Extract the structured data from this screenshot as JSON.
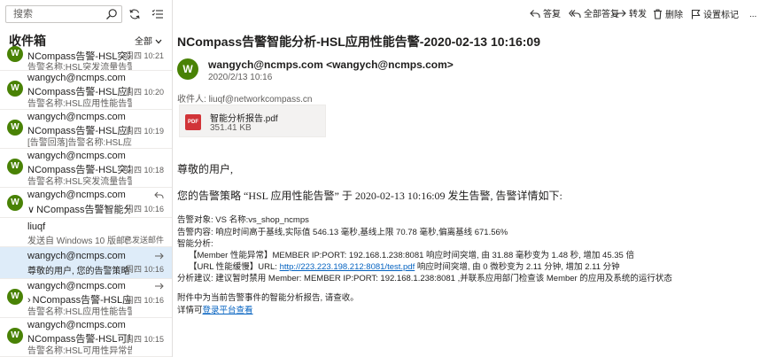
{
  "search": {
    "placeholder": "搜索"
  },
  "folder": {
    "title": "收件箱",
    "filter_label": "全部"
  },
  "messages": [
    {
      "sender": "wangych@ncmps.com",
      "subject": "NCompass告警-HSL突发流量告",
      "preview": "告警名称:HSL突发流量告警,告",
      "time": "周四 10:21"
    },
    {
      "sender": "wangych@ncmps.com",
      "subject": "NCompass告警-HSL应用性能告",
      "preview": "告警名称:HSL应用性能告警,告",
      "time": "周四 10:20"
    },
    {
      "sender": "wangych@ncmps.com",
      "subject": "NCompass告警-HSL应用性能告",
      "preview": "[告警回落]告警名称:HSL应用性能",
      "time": "周四 10:19"
    },
    {
      "sender": "wangych@ncmps.com",
      "subject": "NCompass告警-HSL突发流量告",
      "preview": "告警名称:HSL突发流量告警,告",
      "time": "周四 10:18"
    },
    {
      "sender": "wangych@ncmps.com",
      "subject": "NCompass告警智能分析-HSL",
      "preview": "",
      "time": "周四 10:16"
    },
    {
      "sender": "liuqf",
      "subject": "发送自 Windows 10 版邮件应用",
      "preview": "",
      "time": "已发送邮件"
    },
    {
      "sender": "wangych@ncmps.com",
      "subject": "尊敬的用户,  您的告警策略 \"HS",
      "preview": "",
      "time": "周四 10:16"
    },
    {
      "sender": "wangych@ncmps.com",
      "subject": "NCompass告警-HSL应用性能",
      "preview": "告警名称:HSL应用性能告警,告",
      "time": "周四 10:16"
    },
    {
      "sender": "wangych@ncmps.com",
      "subject": "NCompass告警-HSL可用性异常",
      "preview": "告警名称:HSL可用性异常告警,告",
      "time": "周四 10:15"
    }
  ],
  "top_partial": {
    "subject": "NCompass告警-HSL突发流量告",
    "preview": "告警名称:HSL突发流量告警,告",
    "time": "周四 10:21"
  },
  "toolbar": {
    "reply": "答复",
    "reply_all": "全部答复",
    "forward": "转发",
    "delete": "删除",
    "flag": "设置标记",
    "more": "..."
  },
  "email": {
    "subject": "NCompass告警智能分析-HSL应用性能告警-2020-02-13 10:16:09",
    "avatar_letter": "W",
    "from": "wangych@ncmps.com <wangych@ncmps.com>",
    "date": "2020/2/13 10:16",
    "to_label": "收件人:",
    "to_addr": "liuqf@networkcompass.cn",
    "attachment": {
      "name": "智能分析报告.pdf",
      "size": "351.41 KB",
      "type_label": "PDF"
    },
    "greeting": "尊敬的用户,",
    "policy_line": "您的告警策略 “HSL 应用性能告警” 于 2020-02-13 10:16:09 发生告警, 告警详情如下:",
    "lines": {
      "object": "告警对象:  VS 名称:vs_shop_ncmps",
      "content": "告警内容:  响应时间高于基线,实际值 546.13 毫秒,基线上限 70.78 毫秒,偏离基线 671.56%",
      "analysis_label": "智能分析:",
      "member": "【Member 性能异常】MEMBER IP:PORT: 192.168.1.238:8081 响应时间突增,  由 31.88 毫秒变为 1.48 秒,  增加 45.35 倍",
      "url_prefix": "【URL 性能缓慢】URL: ",
      "url_link": "http://223.223.198.212:8081/test.pdf",
      "url_suffix": " 响应时间突增,  由 0 微秒变为 2.11 分钟,  增加 2.11 分钟",
      "advice": "分析建议:  建议暂时禁用 Member: MEMBER IP:PORT: 192.168.1.238:8081 ,并联系应用部门检查该 Member 的应用及系统的运行状态",
      "attach_note": "附件中为当前告警事件的智能分析报告, 请查收。",
      "detail_prefix": "详情可",
      "detail_link": "登录平台查看"
    }
  },
  "colors": {
    "avatar": "#498205",
    "selected_row": "#deecf9",
    "link": "#0563c1",
    "pdf": "#d13438"
  }
}
